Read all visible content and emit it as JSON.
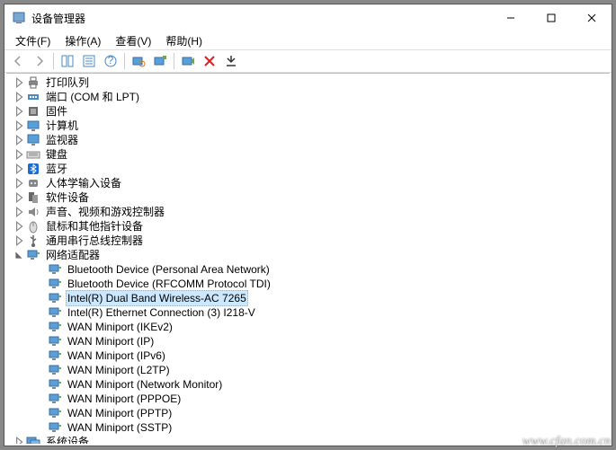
{
  "window": {
    "title": "设备管理器",
    "minimize": "—",
    "maximize": "☐",
    "close": "✕"
  },
  "menubar": {
    "items": [
      "文件(F)",
      "操作(A)",
      "查看(V)",
      "帮助(H)"
    ]
  },
  "tree": {
    "categories": [
      {
        "label": "打印队列",
        "icon": "printer",
        "expanded": false
      },
      {
        "label": "端口 (COM 和 LPT)",
        "icon": "port",
        "expanded": false
      },
      {
        "label": "固件",
        "icon": "firmware",
        "expanded": false
      },
      {
        "label": "计算机",
        "icon": "computer",
        "expanded": false
      },
      {
        "label": "监视器",
        "icon": "monitor",
        "expanded": false
      },
      {
        "label": "键盘",
        "icon": "keyboard",
        "expanded": false
      },
      {
        "label": "蓝牙",
        "icon": "bluetooth",
        "expanded": false
      },
      {
        "label": "人体学输入设备",
        "icon": "hid",
        "expanded": false
      },
      {
        "label": "软件设备",
        "icon": "software",
        "expanded": false
      },
      {
        "label": "声音、视频和游戏控制器",
        "icon": "sound",
        "expanded": false
      },
      {
        "label": "鼠标和其他指针设备",
        "icon": "mouse",
        "expanded": false
      },
      {
        "label": "通用串行总线控制器",
        "icon": "usb",
        "expanded": false
      },
      {
        "label": "网络适配器",
        "icon": "network",
        "expanded": true,
        "children": [
          {
            "label": "Bluetooth Device (Personal Area Network)",
            "icon": "nic"
          },
          {
            "label": "Bluetooth Device (RFCOMM Protocol TDI)",
            "icon": "nic"
          },
          {
            "label": "Intel(R) Dual Band Wireless-AC 7265",
            "icon": "nic",
            "selected": true
          },
          {
            "label": "Intel(R) Ethernet Connection (3) I218-V",
            "icon": "nic"
          },
          {
            "label": "WAN Miniport (IKEv2)",
            "icon": "nic"
          },
          {
            "label": "WAN Miniport (IP)",
            "icon": "nic"
          },
          {
            "label": "WAN Miniport (IPv6)",
            "icon": "nic"
          },
          {
            "label": "WAN Miniport (L2TP)",
            "icon": "nic"
          },
          {
            "label": "WAN Miniport (Network Monitor)",
            "icon": "nic"
          },
          {
            "label": "WAN Miniport (PPPOE)",
            "icon": "nic"
          },
          {
            "label": "WAN Miniport (PPTP)",
            "icon": "nic"
          },
          {
            "label": "WAN Miniport (SSTP)",
            "icon": "nic"
          }
        ]
      },
      {
        "label": "系统设备",
        "icon": "system",
        "expanded": false
      }
    ]
  },
  "watermark": "www.cfan.com.cn"
}
